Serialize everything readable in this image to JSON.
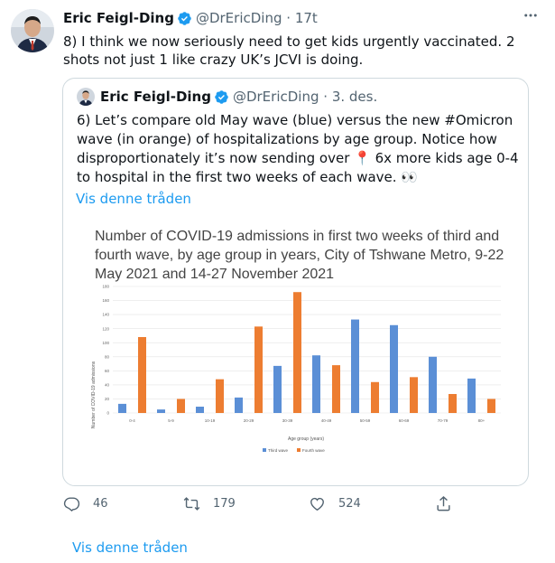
{
  "tweet": {
    "author_name": "Eric Feigl-Ding",
    "handle": "@DrEricDing",
    "time": "17t",
    "text": "8) I think we now seriously need to get kids urgently vaccinated. 2 shots not just 1 like crazy UK’s JCVI is doing.",
    "more_icon": "more-icon"
  },
  "quote": {
    "author_name": "Eric Feigl-Ding",
    "handle": "@DrEricDing",
    "date": "3. des.",
    "text_before_pin": "6) Let’s compare old May wave (blue) versus the new #Omicron wave (in orange) of hospitalizations by age group. Notice how disproportionately it’s now sending over ",
    "pin": "📍",
    "text_after_pin": " 6x more kids age 0-4 to hospital in the first two weeks of each wave. 👀",
    "thread_link": "Vis denne tråden"
  },
  "chart_data": {
    "type": "bar",
    "title": "Number of COVID-19 admissions in first two weeks of third and fourth wave, by age group in years, City of Tshwane Metro, 9-22 May 2021 and 14-27 November 2021",
    "xlabel": "Age group (years)",
    "ylabel": "Number of COVID-19 admissions",
    "categories": [
      "0-4",
      "5-9",
      "10-19",
      "20-29",
      "30-39",
      "40-49",
      "50-59",
      "60-69",
      "70-79",
      "80+"
    ],
    "series": [
      {
        "name": "Third wave",
        "color": "#5b8fd6",
        "values": [
          13,
          5,
          9,
          22,
          67,
          82,
          133,
          125,
          80,
          49
        ]
      },
      {
        "name": "Fourth wave",
        "color": "#ed7d31",
        "values": [
          108,
          20,
          48,
          123,
          172,
          68,
          44,
          51,
          27,
          20
        ]
      }
    ],
    "yticks": [
      0,
      20,
      40,
      60,
      80,
      100,
      120,
      140,
      160,
      180
    ],
    "ylim": [
      0,
      180
    ],
    "legend_position": "bottom"
  },
  "actions": {
    "reply_count": "46",
    "retweet_count": "179",
    "like_count": "524"
  },
  "footer": {
    "thread_link": "Vis denne tråden"
  },
  "colors": {
    "accent": "#1d9bf0",
    "verified": "#1d9bf0"
  }
}
